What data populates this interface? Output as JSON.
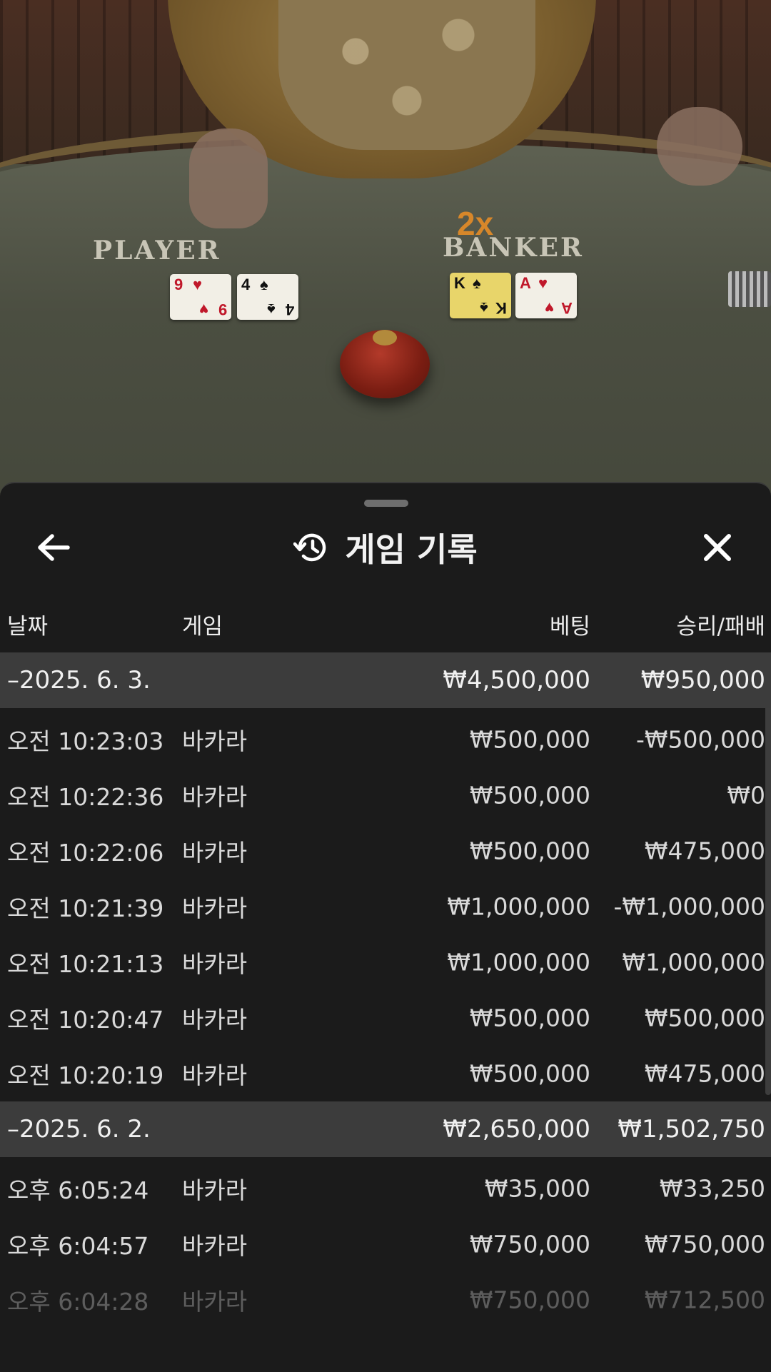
{
  "video": {
    "player_label": "PLAYER",
    "banker_label": "BANKER",
    "multiplier": "2x",
    "player_cards": [
      {
        "rank": "9",
        "suit": "♥",
        "color": "red"
      },
      {
        "rank": "4",
        "suit": "♠",
        "color": "black"
      }
    ],
    "banker_cards": [
      {
        "rank": "K",
        "suit": "♠",
        "color": "black"
      },
      {
        "rank": "A",
        "suit": "♥",
        "color": "red"
      }
    ]
  },
  "sheet": {
    "title": "게임 기록",
    "back_icon": "arrow-left-icon",
    "history_icon": "history-icon",
    "close_icon": "close-icon",
    "columns": {
      "date": "날짜",
      "game": "게임",
      "bet": "베팅",
      "result": "승리/패배"
    },
    "groups": [
      {
        "date": "–2025. 6. 3.",
        "bet_total": "₩4,500,000",
        "result_total": "₩950,000",
        "rows": [
          {
            "time": "오전 10:23:03",
            "game": "바카라",
            "bet": "₩500,000",
            "result": "-₩500,000"
          },
          {
            "time": "오전 10:22:36",
            "game": "바카라",
            "bet": "₩500,000",
            "result": "₩0"
          },
          {
            "time": "오전 10:22:06",
            "game": "바카라",
            "bet": "₩500,000",
            "result": "₩475,000"
          },
          {
            "time": "오전 10:21:39",
            "game": "바카라",
            "bet": "₩1,000,000",
            "result": "-₩1,000,000"
          },
          {
            "time": "오전 10:21:13",
            "game": "바카라",
            "bet": "₩1,000,000",
            "result": "₩1,000,000"
          },
          {
            "time": "오전 10:20:47",
            "game": "바카라",
            "bet": "₩500,000",
            "result": "₩500,000"
          },
          {
            "time": "오전 10:20:19",
            "game": "바카라",
            "bet": "₩500,000",
            "result": "₩475,000"
          }
        ]
      },
      {
        "date": "–2025. 6. 2.",
        "bet_total": "₩2,650,000",
        "result_total": "₩1,502,750",
        "rows": [
          {
            "time": "오후 6:05:24",
            "game": "바카라",
            "bet": "₩35,000",
            "result": "₩33,250"
          },
          {
            "time": "오후 6:04:57",
            "game": "바카라",
            "bet": "₩750,000",
            "result": "₩750,000"
          },
          {
            "time": "오후 6:04:28",
            "game": "바카라",
            "bet": "₩750,000",
            "result": "₩712,500"
          }
        ]
      }
    ]
  }
}
